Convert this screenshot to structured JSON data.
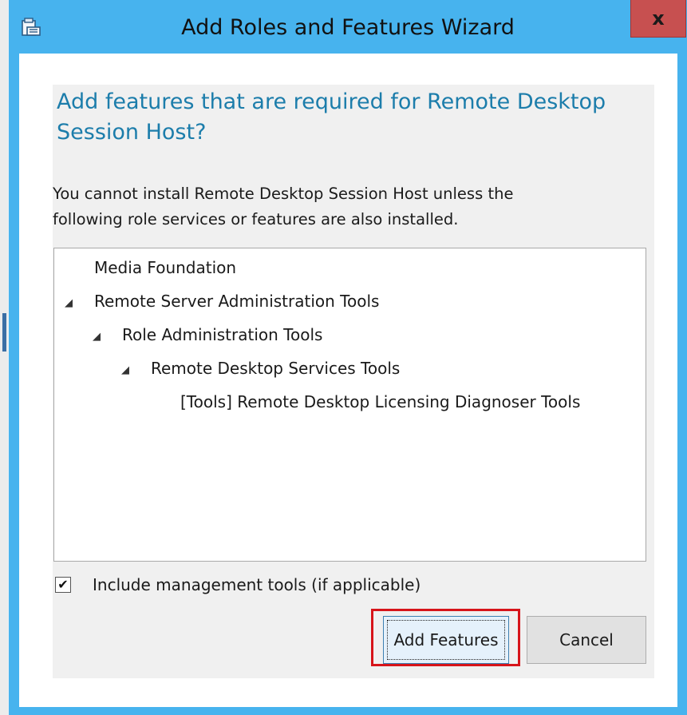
{
  "window": {
    "title": "Add Roles and Features Wizard",
    "close_glyph": "x"
  },
  "dialog": {
    "heading_line1": "Add features that are required for Remote Desktop",
    "heading_line2": "Session Host?",
    "description_line1": "You cannot install Remote Desktop Session Host unless the",
    "description_line2": "following role services or features are also installed.",
    "features": [
      {
        "label": "Media Foundation",
        "level": 0,
        "expandable": false
      },
      {
        "label": "Remote Server Administration Tools",
        "level": 0,
        "expandable": true
      },
      {
        "label": "Role Administration Tools",
        "level": 1,
        "expandable": true
      },
      {
        "label": "Remote Desktop Services Tools",
        "level": 2,
        "expandable": true
      },
      {
        "label": "[Tools] Remote Desktop Licensing Diagnoser Tools",
        "level": 3,
        "expandable": false
      }
    ],
    "expand_glyph": "◢",
    "include_tools_label": "Include management tools (if applicable)",
    "include_tools_checked": true,
    "check_glyph": "✔",
    "add_features_label": "Add Features",
    "cancel_label": "Cancel"
  },
  "colors": {
    "frame": "#47b3ee",
    "heading": "#1c7dab",
    "close_button": "#c75050",
    "highlight": "#d7141a"
  },
  "icons": {
    "app": "server-manager-icon",
    "close": "close-icon",
    "expand": "expand-arrow-icon",
    "check": "checkmark-icon"
  }
}
